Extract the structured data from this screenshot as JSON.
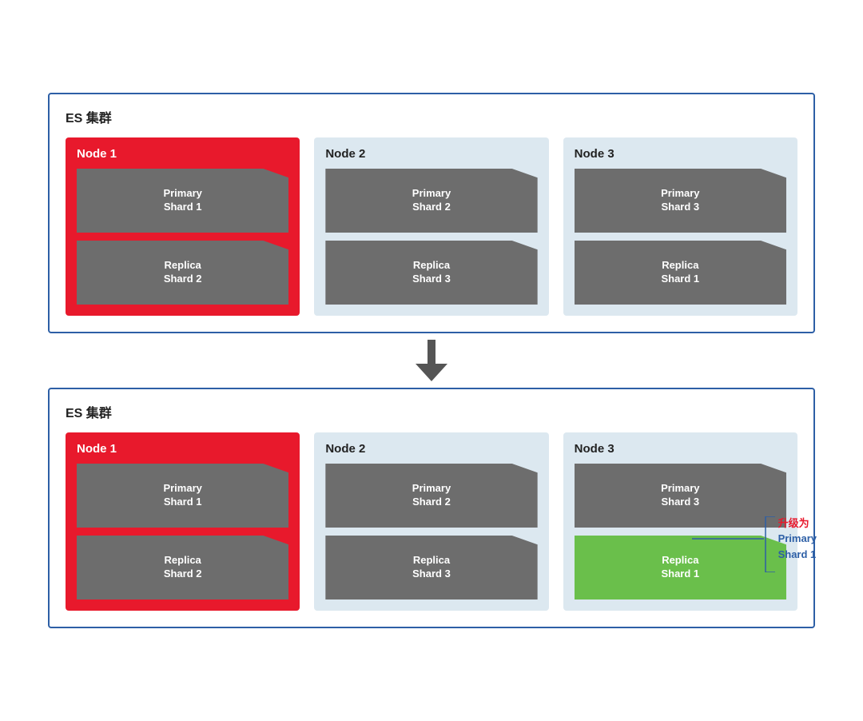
{
  "top_cluster": {
    "label": "ES 集群",
    "nodes": [
      {
        "id": "node1-top",
        "label": "Node 1",
        "style": "red",
        "shards": [
          {
            "id": "ps1-top",
            "line1": "Primary",
            "line2": "Shard 1",
            "style": "normal"
          },
          {
            "id": "rs2-top",
            "line1": "Replica",
            "line2": "Shard 2",
            "style": "normal"
          }
        ]
      },
      {
        "id": "node2-top",
        "label": "Node 2",
        "style": "light",
        "shards": [
          {
            "id": "ps2-top",
            "line1": "Primary",
            "line2": "Shard 2",
            "style": "normal"
          },
          {
            "id": "rs3-top",
            "line1": "Replica",
            "line2": "Shard 3",
            "style": "normal"
          }
        ]
      },
      {
        "id": "node3-top",
        "label": "Node 3",
        "style": "light",
        "shards": [
          {
            "id": "ps3-top",
            "line1": "Primary",
            "line2": "Shard 3",
            "style": "normal"
          },
          {
            "id": "rs1-top",
            "line1": "Replica",
            "line2": "Shard 1",
            "style": "normal"
          }
        ]
      }
    ]
  },
  "bottom_cluster": {
    "label": "ES 集群",
    "nodes": [
      {
        "id": "node1-bot",
        "label": "Node 1",
        "style": "red",
        "shards": [
          {
            "id": "ps1-bot",
            "line1": "Primary",
            "line2": "Shard 1",
            "style": "normal"
          },
          {
            "id": "rs2-bot",
            "line1": "Replica",
            "line2": "Shard 2",
            "style": "normal"
          }
        ]
      },
      {
        "id": "node2-bot",
        "label": "Node 2",
        "style": "light",
        "shards": [
          {
            "id": "ps2-bot",
            "line1": "Primary",
            "line2": "Shard 2",
            "style": "normal"
          },
          {
            "id": "rs3-bot",
            "line1": "Replica",
            "line2": "Shard 3",
            "style": "normal"
          }
        ]
      },
      {
        "id": "node3-bot",
        "label": "Node 3",
        "style": "light",
        "shards": [
          {
            "id": "ps3-bot",
            "line1": "Primary",
            "line2": "Shard 3",
            "style": "normal"
          },
          {
            "id": "rs1-bot",
            "line1": "Replica",
            "line2": "Shard 1",
            "style": "green"
          }
        ]
      }
    ]
  },
  "annotation": {
    "text_line1": "升级为",
    "text_line2": "Primary",
    "text_line3": "Shard 1"
  }
}
